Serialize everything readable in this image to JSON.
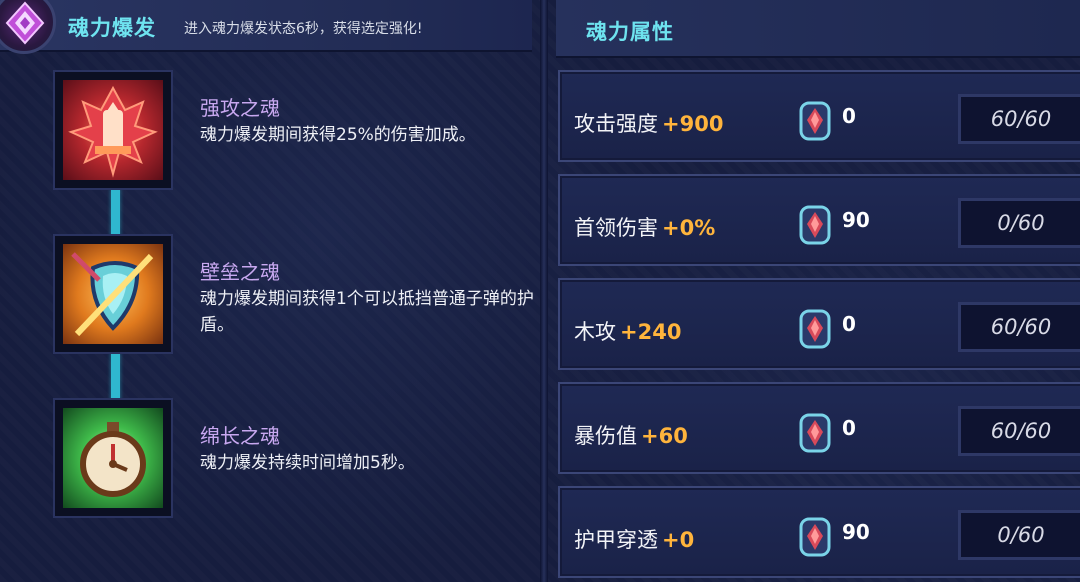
{
  "left_panel": {
    "title": "魂力爆发",
    "subtitle": "进入魂力爆发状态6秒，获得选定强化!",
    "souls": [
      {
        "name": "强攻之魂",
        "desc": "魂力爆发期间获得25%的伤害加成。",
        "icon": "red-crest-icon"
      },
      {
        "name": "壁垒之魂",
        "desc": "魂力爆发期间获得1个可以抵挡普通子弹的护盾。",
        "icon": "shield-icon"
      },
      {
        "name": "绵长之魂",
        "desc": "魂力爆发持续时间增加5秒。",
        "icon": "stopwatch-icon"
      }
    ]
  },
  "right_panel": {
    "title": "魂力属性",
    "attributes": [
      {
        "name": "攻击强度",
        "bonus": "+900",
        "count": "0",
        "level": "60/60"
      },
      {
        "name": "首领伤害",
        "bonus": "+0%",
        "count": "90",
        "level": "0/60"
      },
      {
        "name": "木攻",
        "bonus": "+240",
        "count": "0",
        "level": "60/60"
      },
      {
        "name": "暴伤值",
        "bonus": "+60",
        "count": "0",
        "level": "60/60"
      },
      {
        "name": "护甲穿透",
        "bonus": "+0",
        "count": "90",
        "level": "0/60"
      }
    ]
  },
  "colors": {
    "title_cyan": "#6ee3ef",
    "soul_name_purple": "#c8a8f0",
    "bonus_orange": "#ffb43c",
    "connector_cyan": "#2fb7cf"
  }
}
